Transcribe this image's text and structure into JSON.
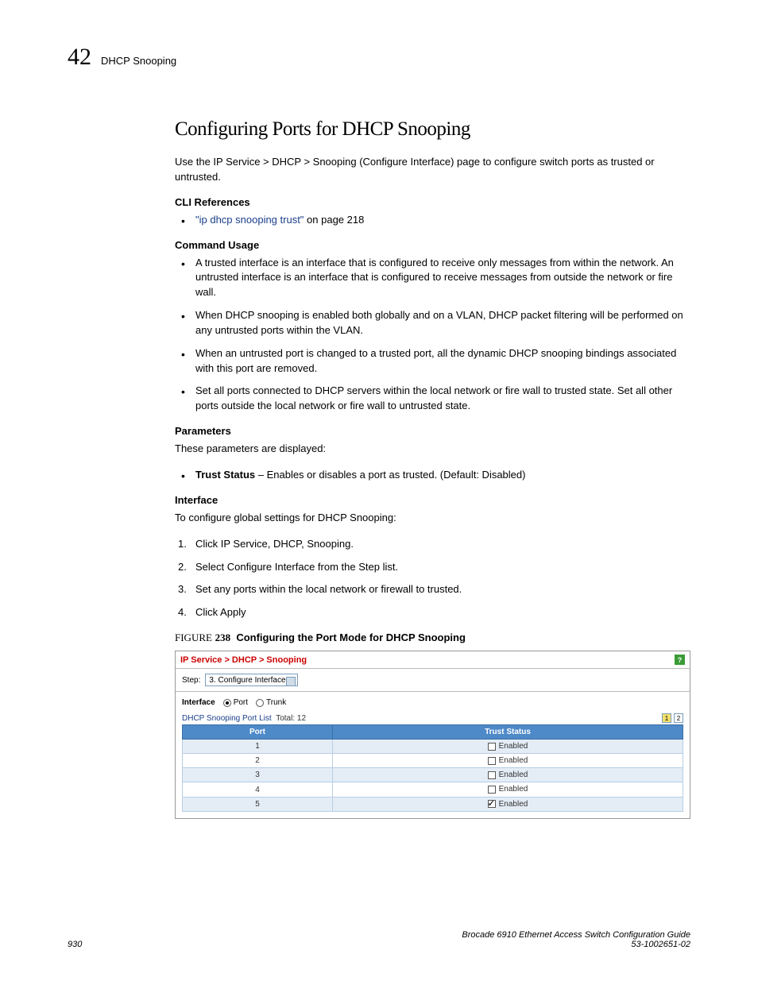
{
  "header": {
    "chapter_number": "42",
    "title": "DHCP Snooping"
  },
  "section": {
    "title": "Configuring Ports for DHCP Snooping",
    "intro": "Use the IP Service > DHCP > Snooping (Configure Interface) page to configure switch ports as trusted or untrusted.",
    "cli_refs_heading": "CLI References",
    "cli_link": "\"ip dhcp snooping trust\"",
    "cli_link_suffix": " on page 218",
    "cmd_usage_heading": "Command Usage",
    "cmd_usage": [
      "A trusted interface is an interface that is configured to receive only messages from within the network. An untrusted interface is an interface that is configured to receive messages from outside the network or fire wall.",
      "When DHCP snooping is enabled both globally and on a VLAN, DHCP packet filtering will be performed on any untrusted ports within the VLAN.",
      "When an untrusted port is changed to a trusted port, all the dynamic DHCP snooping bindings associated with this port are removed.",
      "Set all ports connected to DHCP servers within the local network or fire wall to trusted state. Set all other ports outside the local network or fire wall to untrusted state."
    ],
    "params_heading": "Parameters",
    "params_intro": "These parameters are displayed:",
    "param_name": "Trust Status",
    "param_desc": " – Enables or disables a port as trusted. (Default: Disabled)",
    "iface_heading": "Interface",
    "iface_intro": "To configure global settings for DHCP Snooping:",
    "steps": [
      "Click IP Service, DHCP, Snooping.",
      "Select Configure Interface from the Step list.",
      "Set any ports within the local network or firewall to trusted.",
      "Click Apply"
    ],
    "figure": {
      "word": "FIGURE",
      "number": "238",
      "caption": "Configuring the Port Mode for DHCP Snooping"
    }
  },
  "ui": {
    "breadcrumb": "IP Service > DHCP > Snooping",
    "help": "?",
    "step_label": "Step:",
    "step_value": "3. Configure Interface",
    "interface_label": "Interface",
    "radio_port": "Port",
    "radio_trunk": "Trunk",
    "list_title": "DHCP Snooping Port List",
    "total_label": "Total:",
    "total_value": "12",
    "page_1": "1",
    "page_2": "2",
    "col_port": "Port",
    "col_trust": "Trust Status",
    "enabled_label": "Enabled",
    "rows": [
      {
        "port": "1",
        "checked": false
      },
      {
        "port": "2",
        "checked": false
      },
      {
        "port": "3",
        "checked": false
      },
      {
        "port": "4",
        "checked": false
      },
      {
        "port": "5",
        "checked": true
      }
    ]
  },
  "footer": {
    "page": "930",
    "book_line1": "Brocade 6910 Ethernet Access Switch Configuration Guide",
    "book_line2": "53-1002651-02"
  }
}
